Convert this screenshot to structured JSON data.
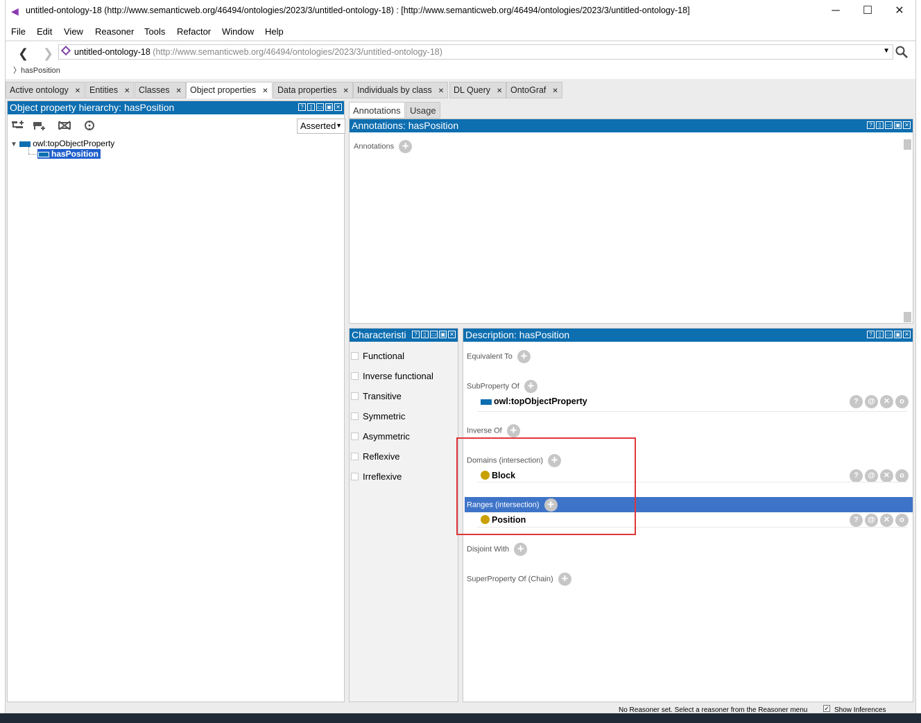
{
  "window": {
    "title": "untitled-ontology-18 (http://www.semanticweb.org/46494/ontologies/2023/3/untitled-ontology-18)  : [http://www.semanticweb.org/46494/ontologies/2023/3/untitled-ontology-18]"
  },
  "menu": [
    "File",
    "Edit",
    "View",
    "Reasoner",
    "Tools",
    "Refactor",
    "Window",
    "Help"
  ],
  "nav": {
    "ontology_name": "untitled-ontology-18",
    "ontology_iri": "(http://www.semanticweb.org/46494/ontologies/2023/3/untitled-ontology-18)",
    "breadcrumb": "hasPosition"
  },
  "tabs": [
    "Active ontology",
    "Entities",
    "Classes",
    "Object properties",
    "Data properties",
    "Individuals by class",
    "DL Query",
    "OntoGraf"
  ],
  "active_tab": "Object properties",
  "hierarchy": {
    "header": "Object property hierarchy: hasPosition",
    "mode": "Asserted",
    "root": "owl:topObjectProperty",
    "child": "hasPosition"
  },
  "annotation_tabs": [
    "Annotations",
    "Usage"
  ],
  "annotations": {
    "header": "Annotations: hasPosition",
    "label": "Annotations"
  },
  "characteristics": {
    "header": "Characteristi",
    "items": [
      "Functional",
      "Inverse functional",
      "Transitive",
      "Symmetric",
      "Asymmetric",
      "Reflexive",
      "Irreflexive"
    ]
  },
  "description": {
    "header": "Description: hasPosition",
    "equivalent_to": "Equivalent To",
    "subproperty_of": "SubProperty Of",
    "subproperty_value": "owl:topObjectProperty",
    "inverse_of": "Inverse Of",
    "domains": "Domains (intersection)",
    "domain_value": "Block",
    "ranges": "Ranges (intersection)",
    "range_value": "Position",
    "disjoint_with": "Disjoint With",
    "superproperty_chain": "SuperProperty Of (Chain)"
  },
  "status": {
    "message": "No Reasoner set. Select a reasoner from the Reasoner menu",
    "show_inferences": "Show Inferences"
  },
  "colors": {
    "header_blue": "#0d6eb0",
    "selected_row": "#3e74c8",
    "class_dot": "#c9a000",
    "highlight": "#e0353a"
  }
}
